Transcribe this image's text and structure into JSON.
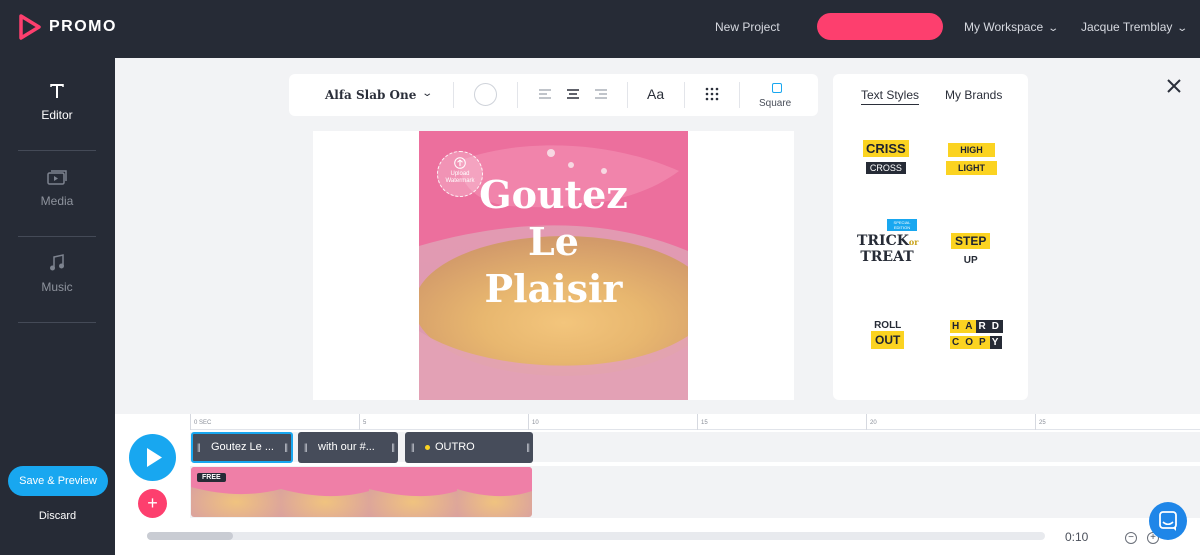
{
  "brand": {
    "name": "PROMO",
    "accent": "#fd3f6e",
    "blue": "#18a7f0"
  },
  "header": {
    "new_project": "New Project",
    "cta_label": "",
    "workspace": "My Workspace",
    "user": "Jacque Tremblay"
  },
  "sidebar": {
    "items": [
      {
        "label": "Editor",
        "icon": "text-icon",
        "active": true
      },
      {
        "label": "Media",
        "icon": "media-icon",
        "active": false
      },
      {
        "label": "Music",
        "icon": "music-icon",
        "active": false
      }
    ],
    "save_preview": "Save & Preview",
    "discard": "Discard"
  },
  "toolbar": {
    "font": "Alfa Slab One",
    "aa_label": "Aa",
    "square_label": "Square"
  },
  "canvas": {
    "headline_lines": [
      "Goutez",
      "Le",
      "Plaisir"
    ],
    "watermark_text": "Upload Watermark"
  },
  "styles_panel": {
    "tabs": [
      {
        "label": "Text Styles",
        "active": true
      },
      {
        "label": "My Brands",
        "active": false
      }
    ],
    "styles": {
      "criss": "CRISS",
      "cross": "CROSS",
      "high": "HIGH",
      "light": "LIGHT",
      "trick_badge": "SPECIAL EDITION",
      "trick": "TRICK",
      "or": "or",
      "treat": "TREAT",
      "step": "STEP",
      "up": "UP",
      "roll": "ROLL",
      "out": "OUT",
      "hard": [
        "H",
        "A",
        "R",
        "D"
      ],
      "copy": [
        "C",
        "O",
        "P",
        "Y"
      ]
    }
  },
  "timeline": {
    "ruler_labels": [
      "0 SEC",
      "5",
      "10",
      "15",
      "20",
      "25"
    ],
    "clips": [
      "Goutez Le ...",
      "with our #...",
      "OUTRO"
    ],
    "free_badge": "FREE",
    "time": "0:10",
    "zoom_out": "−",
    "zoom_in": "+"
  }
}
